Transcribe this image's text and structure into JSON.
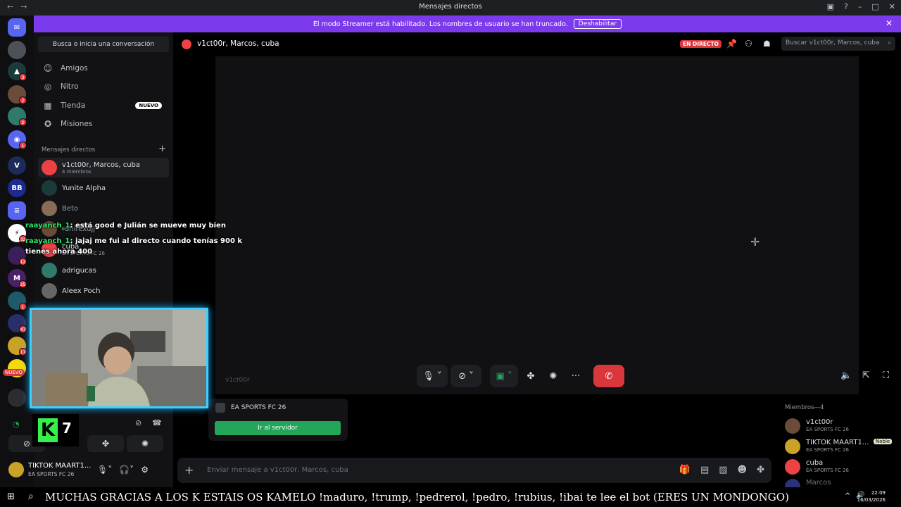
{
  "window": {
    "title": "Mensajes directos"
  },
  "banner": {
    "text": "El modo Streamer está habilitado. Los nombres de usuario se han truncado.",
    "button": "Deshabilitar"
  },
  "guild_badges": [
    "3",
    "2",
    "2",
    "1",
    "32",
    "12",
    "25",
    "1",
    "47",
    "17"
  ],
  "guild_new_label": "NUEVO",
  "sidebar": {
    "search_placeholder": "Busca o inicia una conversación",
    "nav": [
      {
        "label": "Amigos",
        "icon": "friends-icon"
      },
      {
        "label": "Nitro",
        "icon": "nitro-icon"
      },
      {
        "label": "Tienda",
        "icon": "shop-icon",
        "badge": "NUEVO"
      },
      {
        "label": "Misiones",
        "icon": "quests-icon"
      }
    ],
    "dm_header": "Mensajes directos",
    "dms": [
      {
        "name": "v1ct00r, Marcos, cuba",
        "sub": "4 miembros"
      },
      {
        "name": "Yunite Alpha",
        "sub": ""
      },
      {
        "name": "Beto",
        "sub": ""
      },
      {
        "name": "rahirexdjj",
        "sub": ""
      },
      {
        "name": "cuba",
        "sub": "EA SPORTS FC 26"
      },
      {
        "name": "adrigucas",
        "sub": ""
      },
      {
        "name": "Aleex Poch",
        "sub": ""
      }
    ]
  },
  "header": {
    "title": "v1ct00r, Marcos, cuba",
    "live_label": "EN DIRECTO",
    "search_placeholder": "Buscar v1ct00r, Marcos, cuba"
  },
  "stage": {
    "ghost_name": "v1ct00r"
  },
  "activity_card": {
    "game": "EA SPORTS FC 26",
    "button": "Ir al servidor"
  },
  "members": {
    "header": "Miembros—4",
    "list": [
      {
        "name": "v1ct00r",
        "activity": "EA SPORTS FC 26",
        "color": "#6b4b3a"
      },
      {
        "name": "TIKTOK MAART1...",
        "activity": "EA SPORTS FC 26",
        "badge": "Noble",
        "color": "#c9a227"
      },
      {
        "name": "cuba",
        "activity": "EA SPORTS FC 26",
        "color": "#ed4245"
      },
      {
        "name": "Marcos",
        "activity": "",
        "color": "#5865f2"
      }
    ]
  },
  "composer": {
    "placeholder": "Enviar mensaje a v1ct00r, Marcos, cuba"
  },
  "user_panel": {
    "name": "TIKTOK MAART1...",
    "activity": "EA SPORTS FC 26"
  },
  "overlay_chat": [
    {
      "user": "raayanch_1",
      "text": ": está good e Julián se mueve muy bien"
    },
    {
      "user": "raayanch_1",
      "text": ": jajaj me fui al directo cuando tenías 900 k tienes ahora 400"
    }
  ],
  "follower_count": {
    "letter": "K",
    "value": "7"
  },
  "taskbar": {
    "ticker": "MUCHAS GRACIAS A LOS K ESTAIS OS KAMELO !maduro, !trump, !pedrerol, !pedro, !rubius, !ibai te lee el bot (ERES UN MONDONGO)",
    "time": "22:09",
    "date": "16/03/2026"
  }
}
